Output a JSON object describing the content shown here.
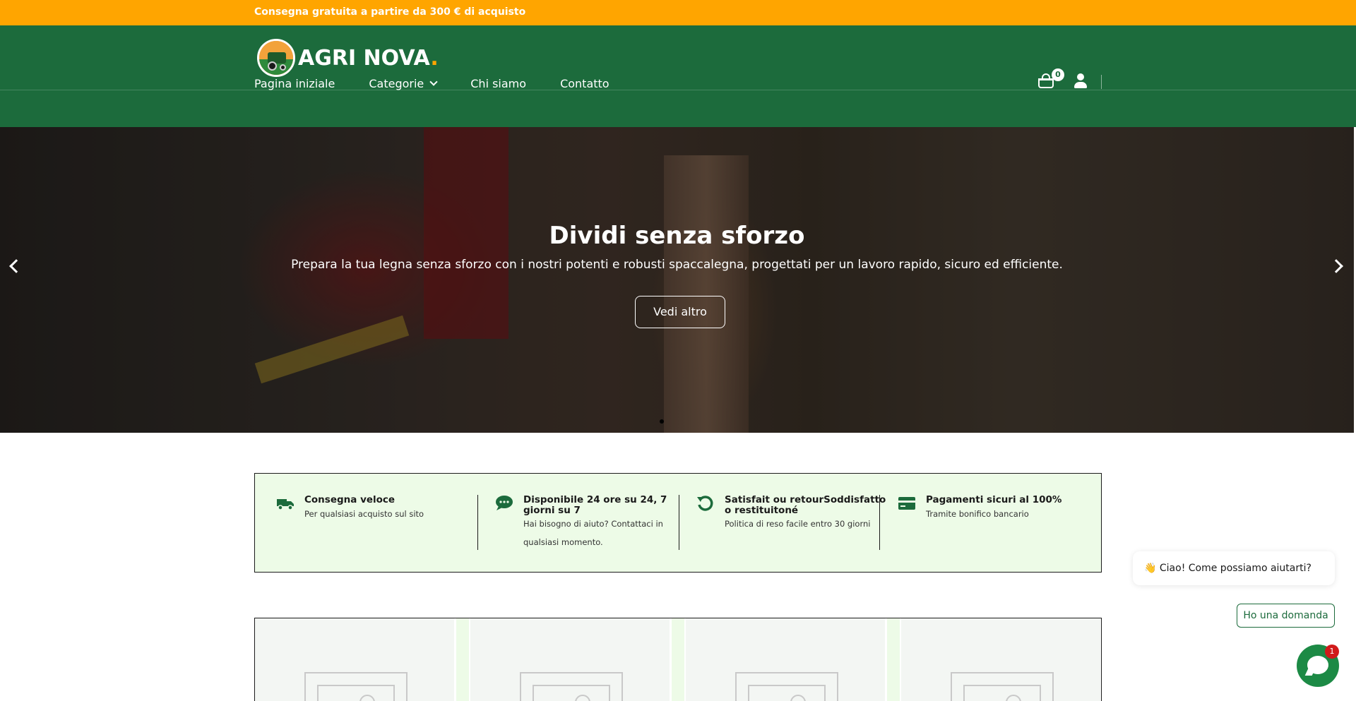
{
  "announcement": {
    "text": "Consegna gratuita a partire da 300 € di acquisto"
  },
  "brand": {
    "name": "AGRI NOVA",
    "dot": "."
  },
  "nav": {
    "items": [
      {
        "label": "Pagina iniziale"
      },
      {
        "label": "Categorie",
        "has_dropdown": true
      },
      {
        "label": "Chi siamo"
      },
      {
        "label": "Contatto"
      }
    ]
  },
  "cart": {
    "count": "0",
    "icon": "basket-icon"
  },
  "account": {
    "icon": "user-icon"
  },
  "hero": {
    "title": "Dividi senza sforzo",
    "subtitle": "Prepara la tua legna senza sforzo con i nostri potenti e robusti spaccalegna, progettati per un lavoro rapido, sicuro ed efficiente.",
    "button_label": "Vedi altro",
    "active_slide": 1,
    "slide_count": 3
  },
  "features": [
    {
      "icon": "truck-icon",
      "title": "Consegna veloce",
      "desc": "Per qualsiasi acquisto sul sito"
    },
    {
      "icon": "chat-icon",
      "title": "Disponibile 24 ore su 24, 7 giorni su 7",
      "desc": "Hai bisogno di aiuto? Contattaci in qualsiasi momento."
    },
    {
      "icon": "return-icon",
      "title": "Satisfait ou retourSoddisfatto o restituitoné",
      "desc": "Politica di reso facile entro 30 giorni"
    },
    {
      "icon": "credit-card-icon",
      "title": "Pagamenti sicuri al 100%",
      "desc": "Tramite bonifico bancario"
    }
  ],
  "chat": {
    "greeting_emoji": "👋",
    "greeting": "Ciao! Come possiamo aiutarti?",
    "question_button": "Ho una domanda",
    "unread": "1"
  },
  "colors": {
    "accent_orange": "#ffa500",
    "brand_green": "#1c6b3c",
    "feature_bg": "#edfbe7"
  }
}
